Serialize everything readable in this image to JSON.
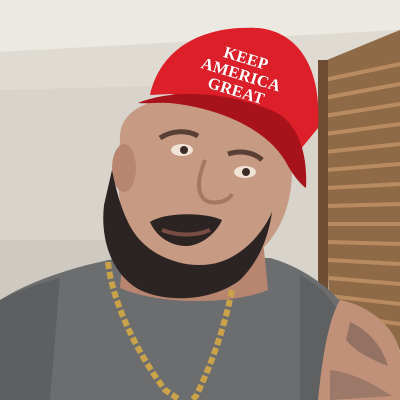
{
  "photo": {
    "hat_text": [
      "KEEP",
      "AMERICA",
      "GREAT"
    ],
    "colors": {
      "hat": "#dd1f2a",
      "hat_shadow": "#a8121b",
      "shirt": "#6c6d6e",
      "skin": "#c69a83",
      "beard": "#2c2422",
      "chain": "#c9a24a",
      "wall": "#d8d4cc",
      "blinds": "#a37c55"
    }
  }
}
